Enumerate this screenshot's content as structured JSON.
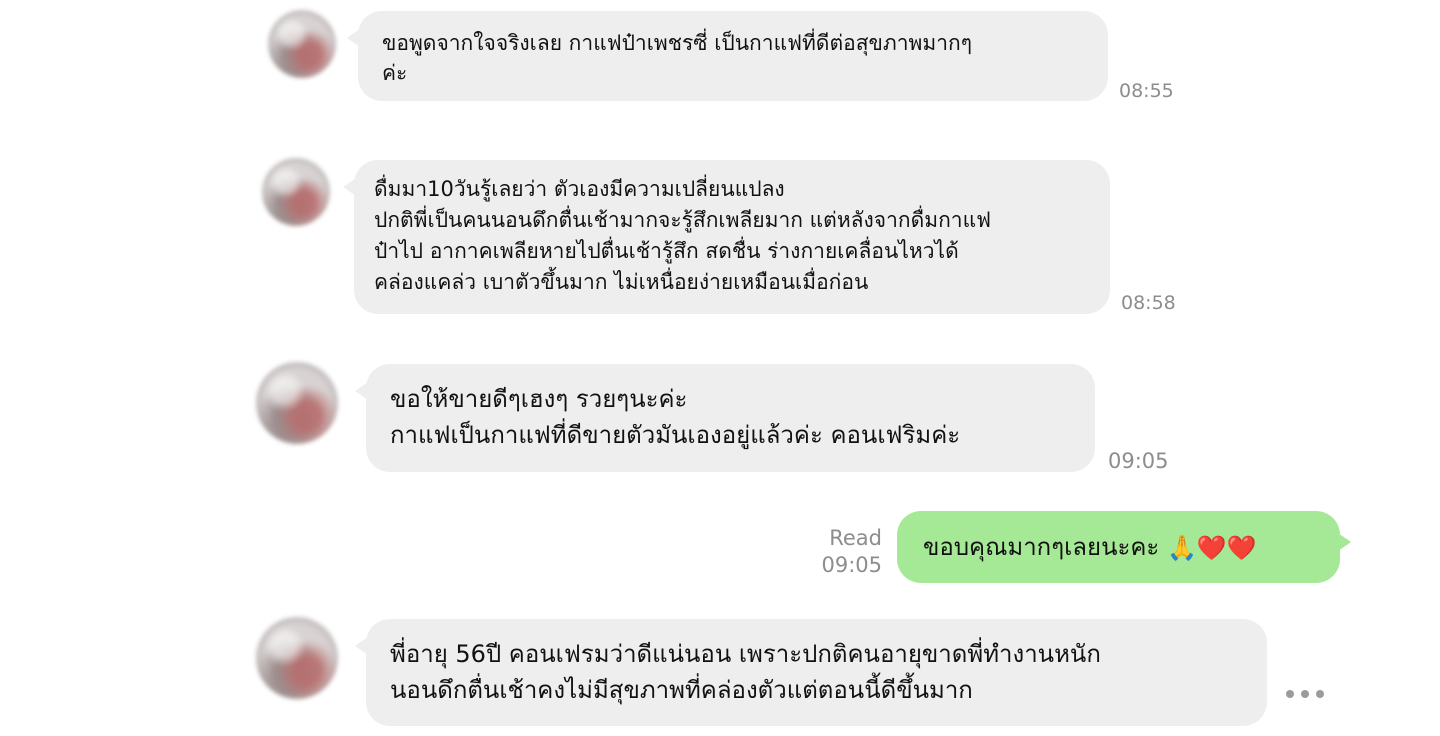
{
  "messages": [
    {
      "direction": "incoming",
      "lines": [
        " ขอพูดจากใจจริงเลย กาแฟป๋าเพชรซี่ เป็นกาแฟที่ดีต่อสุขภาพมากๆ",
        "ค่ะ"
      ],
      "time": "08:55"
    },
    {
      "direction": "incoming",
      "lines": [
        "ดื่มมา10วันรู้เลยว่า ตัวเองมีความเปลี่ยนแปลง",
        "ปกติพี่เป็นคนนอนดึกตื่นเช้ามากจะรู้สึกเพลียมาก แต่หลังจากดื่มกาแฟ",
        "ป๋าไป อากาคเพลียหายไปตื่นเช้ารู้สึก สดชื่น ร่างกายเคลื่อนไหวได้",
        "คล่องแคล่ว เบาตัวขึ้นมาก ไม่เหนื่อยง่ายเหมือนเมื่อก่อน"
      ],
      "time": "08:58"
    },
    {
      "direction": "incoming",
      "lines": [
        "ขอให้ขายดีๆเฮงๆ รวยๆนะค่ะ",
        "กาแฟเป็นกาแฟที่ดีขายตัวมันเองอยู่แล้วค่ะ คอนเฟริมค่ะ"
      ],
      "time": "09:05"
    },
    {
      "direction": "outgoing",
      "lines": [
        "ขอบคุณมากๆเลยนะคะ"
      ],
      "emoji": "🙏❤️❤️",
      "read_label": "Read",
      "time": "09:05"
    },
    {
      "direction": "incoming",
      "lines": [
        "พี่อายุ 56ปี คอนเฟรมว่าดีแน่นอน เพราะปกติคนอายุขาดพี่ทำงานหนัก",
        "นอนดึกตื่นเช้าคงไม่มีสุขภาพที่คล่องตัวแต่ตอนนี้ดีขึ้นมาก"
      ]
    }
  ],
  "colors": {
    "incoming_bubble": "#eeeeef",
    "outgoing_bubble": "#a5e895",
    "timestamp": "#8d8d8d"
  },
  "icons": {
    "more": "more-horizontal-icon"
  }
}
